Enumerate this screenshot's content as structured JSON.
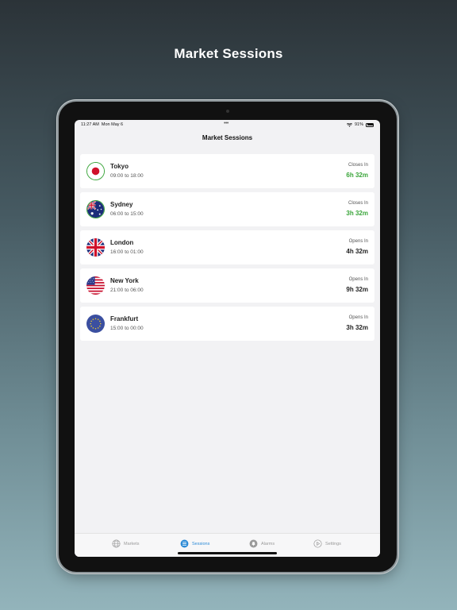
{
  "headline": "Market Sessions",
  "statusbar": {
    "time": "11:27 AM",
    "date": "Mon May 6",
    "battery": "91%",
    "dots": "•••"
  },
  "nav": {
    "title": "Market Sessions"
  },
  "markets": [
    {
      "name": "Tokyo",
      "hours": "09:00 to 18:00",
      "status_label": "Closes In",
      "remaining": "6h 32m",
      "state": "open",
      "flag": "japan-flag-icon"
    },
    {
      "name": "Sydney",
      "hours": "06:00 to 15:00",
      "status_label": "Closes In",
      "remaining": "3h 32m",
      "state": "open",
      "flag": "australia-flag-icon"
    },
    {
      "name": "London",
      "hours": "16:00 to 01:00",
      "status_label": "Opens In",
      "remaining": "4h 32m",
      "state": "closed",
      "flag": "uk-flag-icon"
    },
    {
      "name": "New York",
      "hours": "21:00 to 06:00",
      "status_label": "Opens In",
      "remaining": "9h 32m",
      "state": "closed",
      "flag": "us-flag-icon"
    },
    {
      "name": "Frankfurt",
      "hours": "15:00 to 00:00",
      "status_label": "Opens In",
      "remaining": "3h 32m",
      "state": "closed",
      "flag": "eu-flag-icon"
    }
  ],
  "tabs": [
    {
      "label": "Markets",
      "icon": "globe-icon",
      "active": false
    },
    {
      "label": "Sessions",
      "icon": "list-icon",
      "active": true
    },
    {
      "label": "Alarms",
      "icon": "bell-icon",
      "active": false
    },
    {
      "label": "Settings",
      "icon": "play-icon",
      "active": false
    }
  ],
  "colors": {
    "open": "#3aa53a",
    "closed": "#222222",
    "accent": "#2d8bd6"
  }
}
